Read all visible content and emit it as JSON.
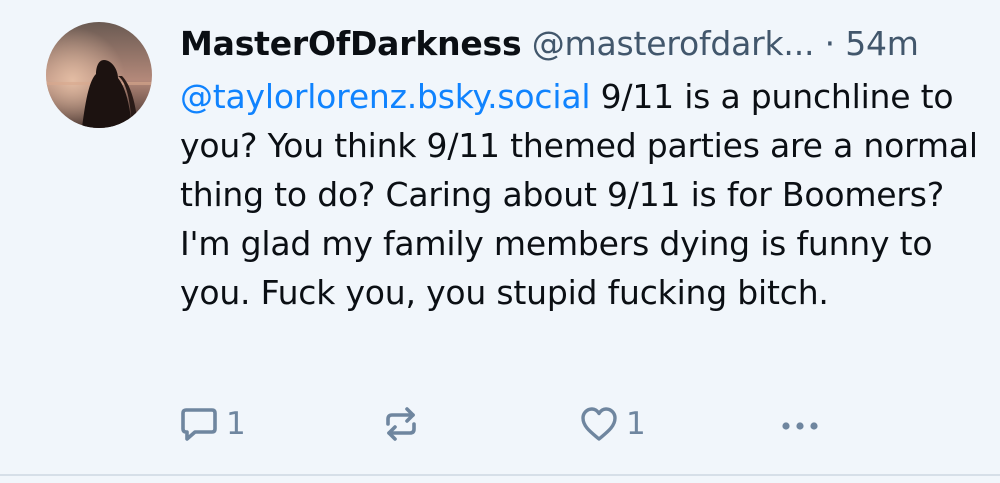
{
  "post": {
    "author": {
      "display_name": "MasterOfDarkness",
      "handle": "@masterofdark...",
      "avatar": "avatar-silhouette"
    },
    "separator": "·",
    "time": "54m",
    "mention": "@taylorlorenz.bsky.social",
    "text": " 9/11 is a punchline to you? You think 9/11 themed parties are a normal thing to do? Caring about 9/11 is for Boomers? I'm glad my family members dying is funny to you. Fuck you, you stupid fucking bitch.",
    "actions": {
      "reply_count": "1",
      "like_count": "1",
      "reply_icon": "reply-icon",
      "repost_icon": "repost-icon",
      "like_icon": "heart-icon",
      "more_icon": "more-icon"
    }
  },
  "colors": {
    "background": "#f1f6fb",
    "mention": "#1083fe",
    "muted": "#42576c",
    "icon": "#6f869f"
  }
}
